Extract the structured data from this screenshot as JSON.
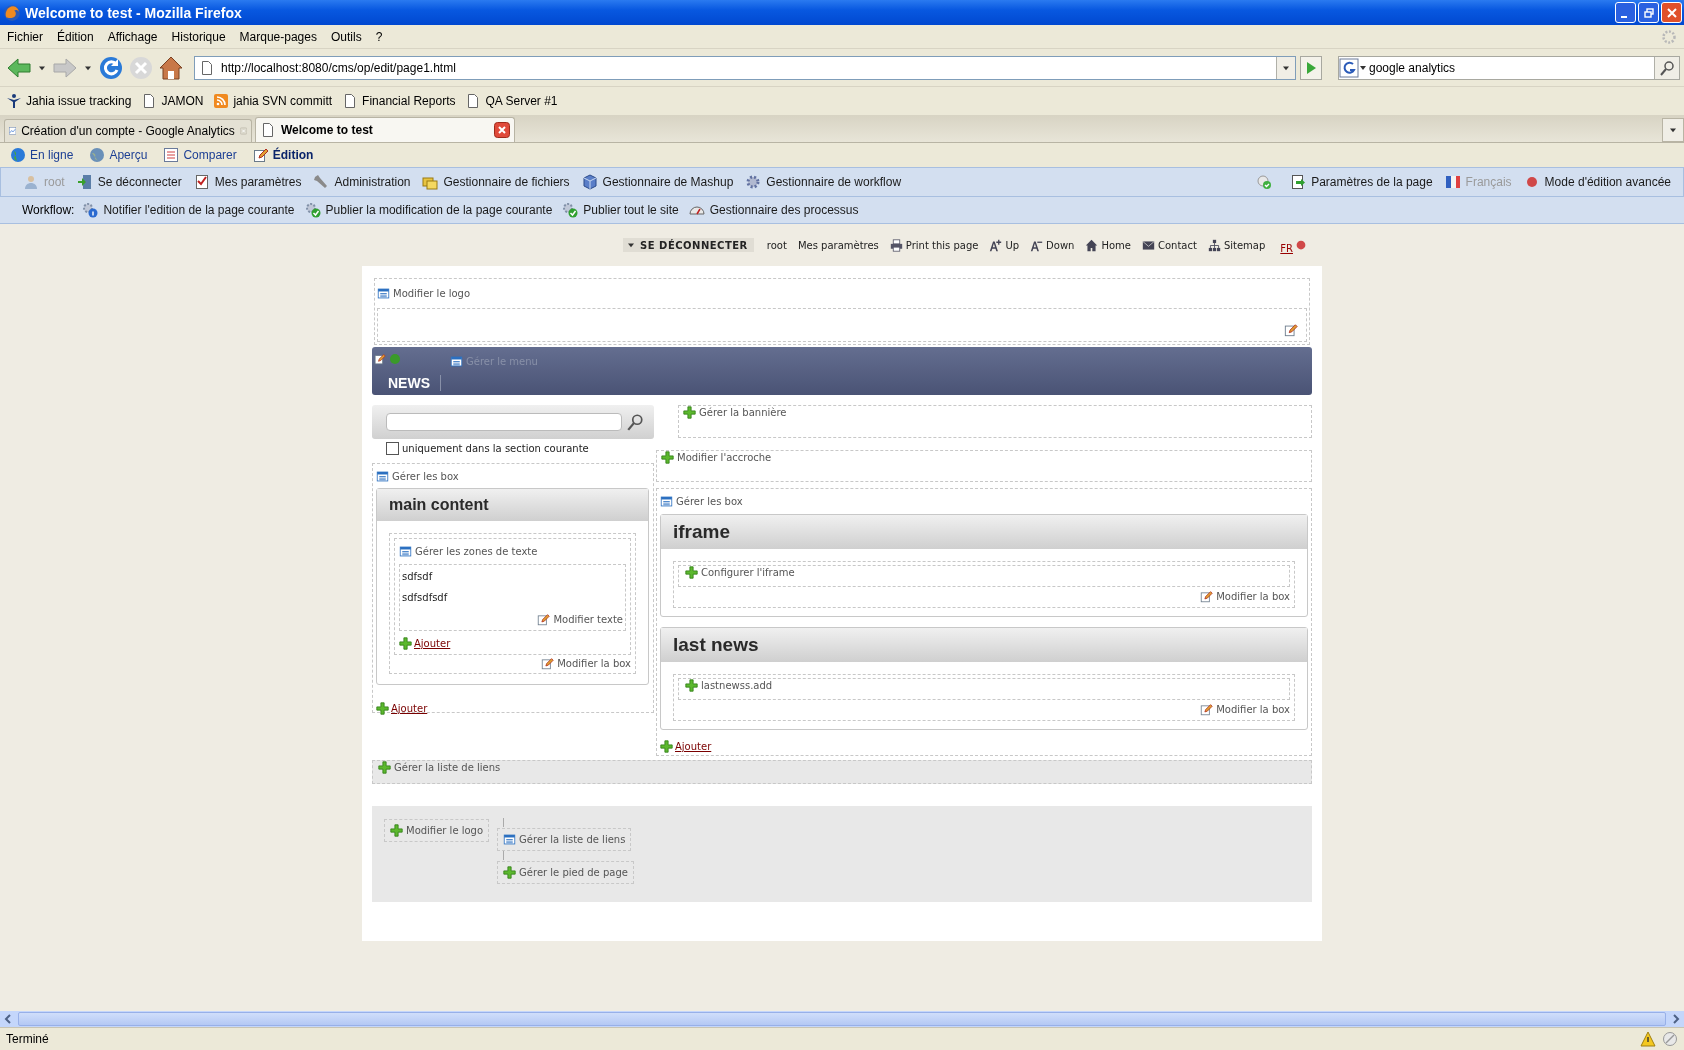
{
  "window": {
    "title": "Welcome to test - Mozilla Firefox"
  },
  "menu": [
    "Fichier",
    "Édition",
    "Affichage",
    "Historique",
    "Marque-pages",
    "Outils",
    "?"
  ],
  "address_bar": {
    "url": "http://localhost:8080/cms/op/edit/page1.html"
  },
  "search": {
    "value": "google analytics"
  },
  "bookmarks": [
    {
      "label": "Jahia issue tracking",
      "kind": "jahia"
    },
    {
      "label": "JAMON",
      "kind": "page"
    },
    {
      "label": "jahia SVN committ",
      "kind": "rss"
    },
    {
      "label": "Financial Reports",
      "kind": "page"
    },
    {
      "label": "QA Server #1",
      "kind": "page"
    }
  ],
  "tabs": [
    {
      "label": "Création d'un compte - Google Analytics",
      "selected": false
    },
    {
      "label": "Welcome to test",
      "selected": true
    }
  ],
  "modes": [
    {
      "label": "En ligne",
      "kind": "globe",
      "selected": false
    },
    {
      "label": "Aperçu",
      "kind": "preview",
      "selected": false
    },
    {
      "label": "Comparer",
      "kind": "compare",
      "selected": false
    },
    {
      "label": "Édition",
      "kind": "edit",
      "selected": true
    }
  ],
  "toolbar": {
    "left": [
      {
        "label": "root",
        "kind": "user",
        "disabled": true
      },
      {
        "label": "Se déconnecter",
        "kind": "logout",
        "disabled": false
      },
      {
        "label": "Mes paramètres",
        "kind": "settings",
        "disabled": false
      },
      {
        "label": "Administration",
        "kind": "tools",
        "disabled": false
      },
      {
        "label": "Gestionnaire de fichiers",
        "kind": "files",
        "disabled": false
      },
      {
        "label": "Gestionnaire de Mashup",
        "kind": "mashup",
        "disabled": false
      },
      {
        "label": "Gestionnaire de workflow",
        "kind": "workflow",
        "disabled": false
      }
    ],
    "right": [
      {
        "label": "Paramètres de la page",
        "kind": "page_settings",
        "disabled": false
      },
      {
        "label": "Français",
        "kind": "flag",
        "disabled": true
      },
      {
        "label": "Mode d'édition avancée",
        "kind": "dot",
        "disabled": false
      }
    ]
  },
  "workflow": {
    "label": "Workflow:",
    "items": [
      {
        "label": "Notifier l'edition de la page courante",
        "kind": "info"
      },
      {
        "label": "Publier la modification de la page courante",
        "kind": "publish"
      },
      {
        "label": "Publier tout le site",
        "kind": "publish"
      },
      {
        "label": "Gestionnaire des processus",
        "kind": "process"
      }
    ]
  },
  "site_nav": {
    "items": [
      {
        "label": "SE DÉCONNECTER",
        "kind": "dropdown"
      },
      {
        "label": "root",
        "kind": "text"
      },
      {
        "label": "Mes paramètres",
        "kind": "text"
      },
      {
        "label": "Print this page",
        "kind": "print"
      },
      {
        "label": "Up",
        "kind": "font_up"
      },
      {
        "label": "Down",
        "kind": "font_down"
      },
      {
        "label": "Home",
        "kind": "home"
      },
      {
        "label": "Contact",
        "kind": "mail"
      },
      {
        "label": "Sitemap",
        "kind": "sitemap"
      }
    ],
    "language": "FR"
  },
  "logo_zone": {
    "action": {
      "label": "Modifier le logo",
      "kind": "list"
    }
  },
  "nav_bar": {
    "menu_action": {
      "label": "Gérer le menu",
      "kind": "list"
    },
    "items": [
      "NEWS"
    ]
  },
  "search_box": {
    "checkbox": {
      "label": "uniquement dans la section courante",
      "checked": false
    }
  },
  "banner": {
    "action": {
      "label": "Gérer la bannière",
      "kind": "add"
    }
  },
  "tagline": {
    "action": {
      "label": "Modifier l'accroche",
      "kind": "add"
    }
  },
  "left_column": {
    "manage": {
      "label": "Gérer les box",
      "kind": "list"
    },
    "box": {
      "title": "main content",
      "manage": {
        "label": "Gérer les zones de texte",
        "kind": "list"
      },
      "texts": [
        "sdfsdf",
        "sdfsdfsdf"
      ],
      "edit_text": "Modifier texte",
      "add": "Ajouter",
      "edit_box": "Modifier la box"
    },
    "add": "Ajouter"
  },
  "right_column": {
    "manage": {
      "label": "Gérer les box",
      "kind": "list"
    },
    "boxes": [
      {
        "title": "iframe",
        "action": {
          "label": "Configurer l'iframe",
          "kind": "add"
        },
        "edit_box": "Modifier la box"
      },
      {
        "title": "last news",
        "action": {
          "label": "lastnewss.add",
          "kind": "add"
        },
        "edit_box": "Modifier la box"
      }
    ],
    "add": "Ajouter"
  },
  "links_bar": {
    "action": {
      "label": "Gérer la liste de liens",
      "kind": "add"
    }
  },
  "footer": {
    "logo_action": {
      "label": "Modifier le logo",
      "kind": "add"
    },
    "links_action": {
      "label": "Gérer la liste de liens",
      "kind": "list"
    },
    "footer_action": {
      "label": "Gérer le pied de page",
      "kind": "add"
    }
  },
  "status_bar": {
    "text": "Terminé"
  }
}
